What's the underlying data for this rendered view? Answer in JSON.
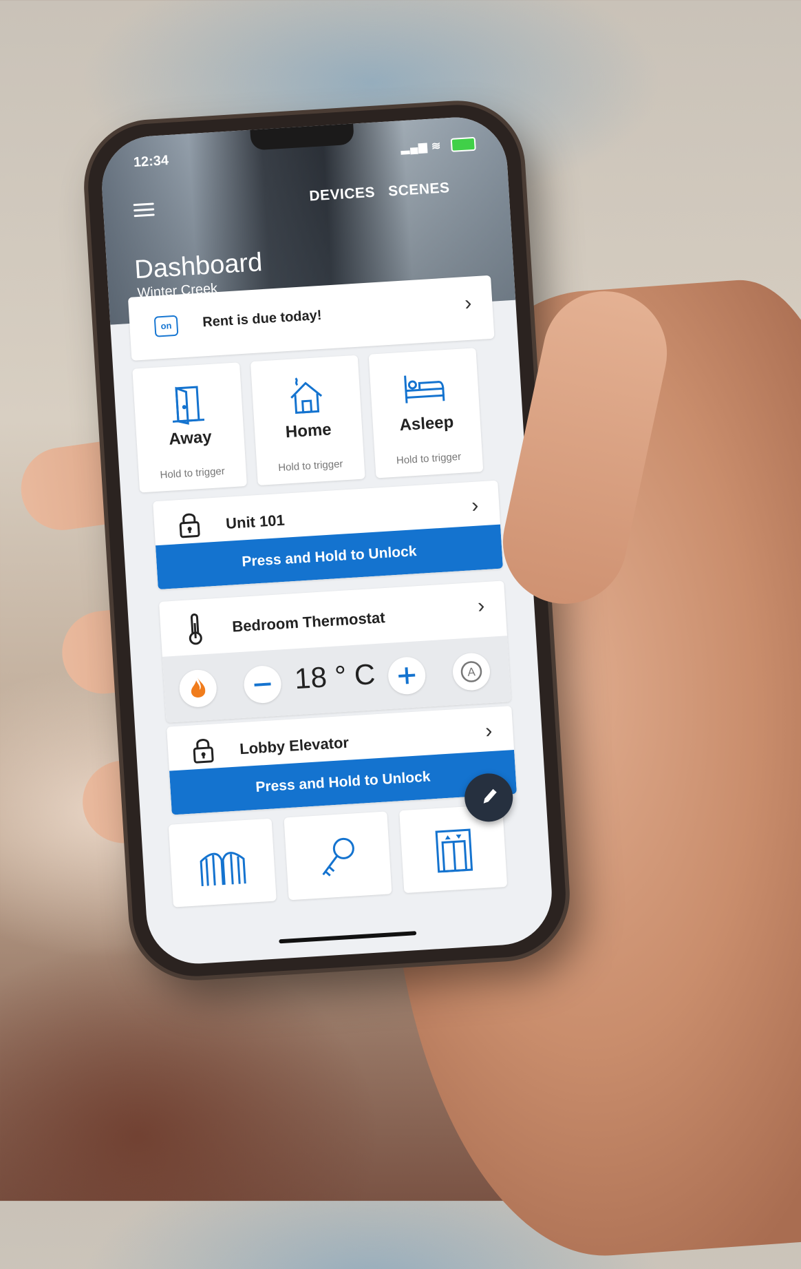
{
  "status": {
    "time": "12:34"
  },
  "nav": {
    "devices": "DEVICES",
    "scenes": "SCENES"
  },
  "header": {
    "title": "Dashboard",
    "subtitle": "Winter Creek"
  },
  "notice": {
    "text": "Rent is due today!",
    "icon": "calendar-icon"
  },
  "scenes": [
    {
      "name": "Away",
      "hint": "Hold to trigger",
      "icon": "door-open-icon"
    },
    {
      "name": "Home",
      "hint": "Hold to trigger",
      "icon": "house-icon"
    },
    {
      "name": "Asleep",
      "hint": "Hold to trigger",
      "icon": "bed-icon"
    }
  ],
  "locks": [
    {
      "name": "Unit 101",
      "button": "Press and Hold to Unlock"
    },
    {
      "name": "Lobby Elevator",
      "button": "Press and Hold to Unlock"
    }
  ],
  "thermostat": {
    "name": "Bedroom Thermostat",
    "temperature": "18 ° C",
    "mode_icon": "flame-icon"
  },
  "colors": {
    "accent": "#1473cf",
    "fab": "#26303f",
    "flame": "#f07c1c"
  }
}
